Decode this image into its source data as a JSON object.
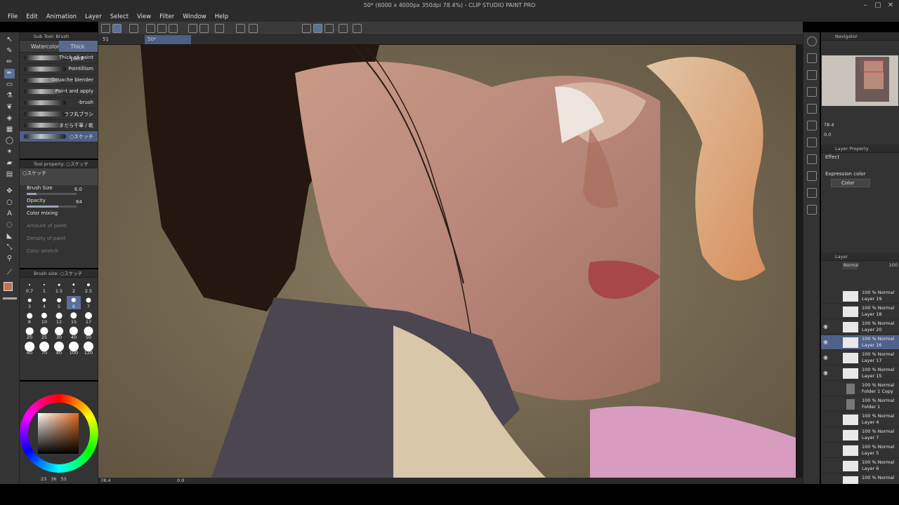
{
  "window": {
    "title": "50* (6000 x 4000px 350dpi 78.4%) - CLIP STUDIO PAINT PRO"
  },
  "menu": [
    "File",
    "Edit",
    "Animation",
    "Layer",
    "Select",
    "View",
    "Filter",
    "Window",
    "Help"
  ],
  "canvas_tabs": {
    "tab1": "51",
    "tab2": "50*"
  },
  "sub_tool": {
    "header": "Sub Tool: Brush",
    "tabs": [
      "Watercolor",
      "Thick paint"
    ],
    "brushes": [
      "Thick oil paint",
      "Pointillism",
      "Gouache blender",
      "Paint and apply",
      "-brush",
      "ラフ丸ブラシ",
      "まだら千筆 / 乾",
      "○スケッチ"
    ],
    "selected_brush": "○スケッチ"
  },
  "tool_property": {
    "header": "Tool property: ○スケッチ",
    "brush_label": "○スケッチ",
    "brush_size_label": "Brush Size",
    "brush_size_value": "6.0",
    "opacity_label": "Opacity",
    "opacity_value": "64",
    "opacity_fraction": 0.64,
    "color_mixing_label": "Color mixing",
    "amount_of_paint_label": "Amount of paint",
    "density_of_paint_label": "Density of paint",
    "color_stretch_label": "Color stretch"
  },
  "brush_size_panel": {
    "header": "Brush size: ○スケッチ",
    "sizes": [
      "0.7",
      "1",
      "1.5",
      "2",
      "2.5",
      "3",
      "4",
      "5",
      "6",
      "7",
      "8",
      "10",
      "12",
      "15",
      "17",
      "20",
      "25",
      "30",
      "40",
      "50",
      "60",
      "70",
      "80",
      "100",
      "120"
    ],
    "selected": "6"
  },
  "color_panel": {
    "bottom_values": [
      "23",
      "36",
      "55"
    ],
    "main_color": "#c8704e"
  },
  "status": {
    "zoom": "78.4",
    "rotation": "0.0"
  },
  "navigator": {
    "header": "Navigator",
    "zoom": "78.4",
    "rotation": "0.0"
  },
  "layer_property": {
    "header": "Layer Property",
    "effect_label": "Effect",
    "expression_label": "Expression color",
    "expression_value": "Color"
  },
  "layers_panel": {
    "header": "Layer",
    "blend_mode": "Normal",
    "opacity": "100",
    "layers": [
      {
        "pct": "100 % Normal",
        "name": "Layer 19",
        "visible": false
      },
      {
        "pct": "100 % Normal",
        "name": "Layer 18",
        "visible": false
      },
      {
        "pct": "100 % Normal",
        "name": "Layer 20",
        "visible": true
      },
      {
        "pct": "100 % Normal",
        "name": "Layer 16",
        "visible": true,
        "selected": true
      },
      {
        "pct": "100 % Normal",
        "name": "Layer 17",
        "visible": true
      },
      {
        "pct": "100 % Normal",
        "name": "Layer 15",
        "visible": true
      },
      {
        "pct": "100 % Normal",
        "name": "Folder 1 Copy",
        "visible": false,
        "folder": true
      },
      {
        "pct": "100 % Normal",
        "name": "Folder 1",
        "visible": false,
        "folder": true
      },
      {
        "pct": "100 % Normal",
        "name": "Layer 4",
        "visible": false
      },
      {
        "pct": "100 % Normal",
        "name": "Layer 7",
        "visible": false
      },
      {
        "pct": "100 % Normal",
        "name": "Layer 5",
        "visible": false
      },
      {
        "pct": "100 % Normal",
        "name": "Layer 6",
        "visible": false
      },
      {
        "pct": "100 % Normal",
        "name": "",
        "visible": false
      }
    ]
  },
  "icons": [
    "pen-icon",
    "pencil-icon",
    "brush-icon",
    "eraser-icon",
    "fill-icon",
    "eyedropper-icon",
    "lasso-icon",
    "text-icon",
    "zoom-icon"
  ]
}
